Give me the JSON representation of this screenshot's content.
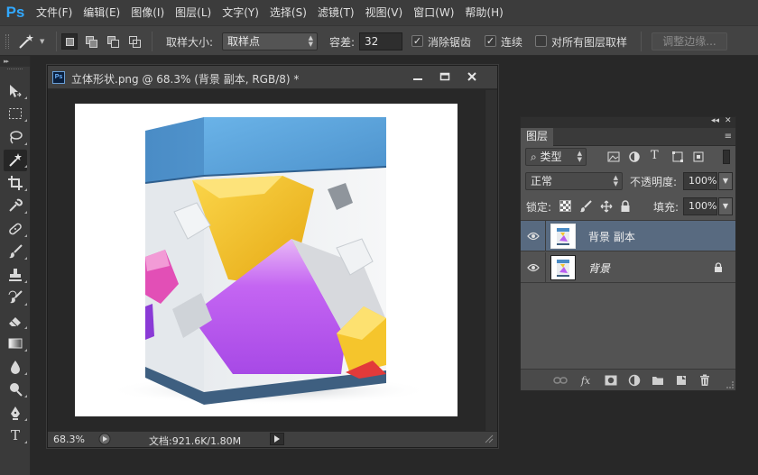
{
  "app": {
    "logo": "Ps"
  },
  "menu": [
    "文件(F)",
    "编辑(E)",
    "图像(I)",
    "图层(L)",
    "文字(Y)",
    "选择(S)",
    "滤镜(T)",
    "视图(V)",
    "窗口(W)",
    "帮助(H)"
  ],
  "options": {
    "sample_size_label": "取样大小:",
    "sample_size_value": "取样点",
    "tolerance_label": "容差:",
    "tolerance_value": "32",
    "antialias_label": "消除锯齿",
    "antialias_checked": "✓",
    "contiguous_label": "连续",
    "contiguous_checked": "✓",
    "sample_all_label": "对所有图层取样",
    "refine_edge_label": "调整边缘..."
  },
  "toolbox": {
    "collapse_glyph": "▸▸",
    "type_tool_glyph": "T",
    "tools": [
      "move-tool",
      "rectangular-marquee-tool",
      "lasso-tool",
      "magic-wand-tool",
      "crop-tool",
      "eyedropper-tool",
      "spot-healing-tool",
      "brush-tool",
      "clone-stamp-tool",
      "history-brush-tool",
      "eraser-tool",
      "gradient-tool",
      "blur-tool",
      "dodge-tool",
      "pen-tool",
      "type-tool"
    ],
    "active": "magic-wand-tool"
  },
  "document": {
    "icon_label": "Ps",
    "title": "立体形状.png @ 68.3% (背景 副本, RGB/8) *",
    "zoom": "68.3%",
    "doc_info": "文档:921.6K/1.80M"
  },
  "layers_panel": {
    "collapse": "◂◂",
    "close": "✕",
    "menu_icon": "≡",
    "tab": "图层",
    "filter_type": "类型",
    "blend_mode": "正常",
    "opacity_label": "不透明度:",
    "opacity_value": "100%",
    "lock_label": "锁定:",
    "fill_label": "填充:",
    "fill_value": "100%",
    "layers": [
      {
        "name": "背景 副本",
        "selected": true,
        "visible": true,
        "locked": false
      },
      {
        "name": "背景",
        "selected": false,
        "visible": true,
        "locked": true
      }
    ],
    "bottom_fx": "fx"
  },
  "colors": {
    "accent": "#31a8ff",
    "selected_layer": "#586a80",
    "panel": "#535353"
  }
}
